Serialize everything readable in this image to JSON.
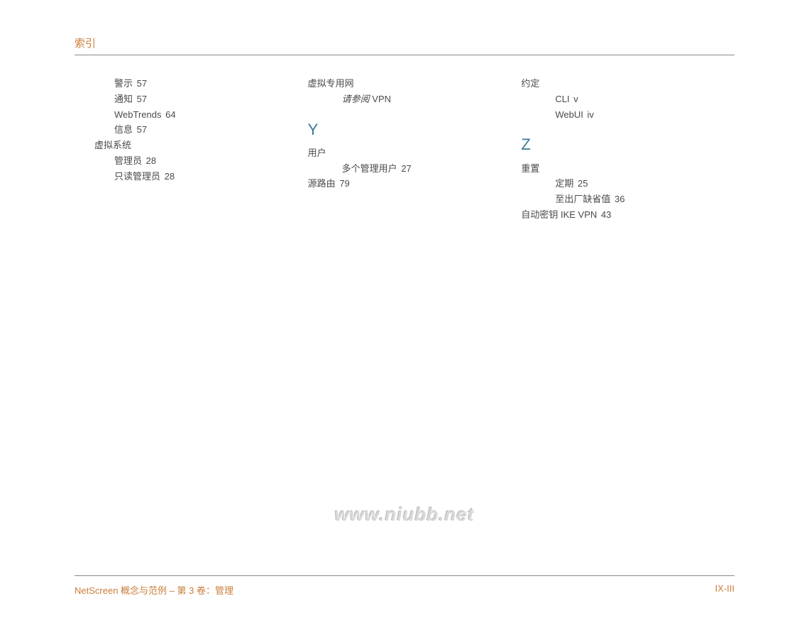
{
  "header": {
    "title": "索引"
  },
  "col1": {
    "items": [
      {
        "text": "警示",
        "page": "57",
        "level": 1
      },
      {
        "text": "通知",
        "page": "57",
        "level": 1
      },
      {
        "text": "WebTrends",
        "page": "64",
        "level": 1
      },
      {
        "text": "信息",
        "page": "57",
        "level": 1
      },
      {
        "text": "虚拟系统",
        "page": "",
        "level": 0
      },
      {
        "text": "管理员",
        "page": "28",
        "level": 1
      },
      {
        "text": "只读管理员",
        "page": "28",
        "level": 1
      }
    ]
  },
  "col2": {
    "top": [
      {
        "text": "虚拟专用网",
        "page": "",
        "level": 0
      },
      {
        "prefix": "请参阅",
        "text": " VPN",
        "page": "",
        "level": 2,
        "italicPrefix": true
      }
    ],
    "letter": "Y",
    "items": [
      {
        "text": "用户",
        "page": "",
        "level": 0
      },
      {
        "text": "多个管理用户",
        "page": "27",
        "level": 2
      },
      {
        "text": "源路由",
        "page": "79",
        "level": 0
      }
    ]
  },
  "col3": {
    "top": [
      {
        "text": "约定",
        "page": "",
        "level": 0
      },
      {
        "text": "CLI",
        "page": "v",
        "level": 2
      },
      {
        "text": "WebUI",
        "page": "iv",
        "level": 2
      }
    ],
    "letter": "Z",
    "items": [
      {
        "text": "重置",
        "page": "",
        "level": 0
      },
      {
        "text": "定期",
        "page": "25",
        "level": 2
      },
      {
        "text": "至出厂缺省值",
        "page": "36",
        "level": 2
      },
      {
        "text": "自动密钥 IKE VPN",
        "page": "43",
        "level": 0
      }
    ]
  },
  "watermark": "www.niubb.net",
  "footer": {
    "left": "NetScreen 概念与范例 – 第 3 卷：管理",
    "right": "IX-III"
  }
}
